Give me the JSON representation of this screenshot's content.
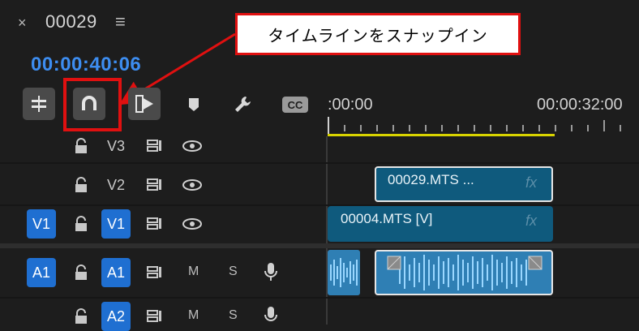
{
  "sequence": {
    "close_glyph": "×",
    "name": "00029",
    "menu_glyph": "≡",
    "timecode": "00:00:40:06"
  },
  "callout": {
    "text": "タイムラインをスナップイン"
  },
  "toolbar": {
    "cc_label": "CC"
  },
  "ruler": {
    "start_label": ":00:00",
    "mark_label": "00:00:32:00"
  },
  "tracks": {
    "v3": {
      "name": "V3"
    },
    "v2": {
      "name": "V2"
    },
    "v1": {
      "source": "V1",
      "name": "V1"
    },
    "a1": {
      "source": "A1",
      "name": "A1",
      "mute": "M",
      "solo": "S"
    },
    "a2": {
      "name": "A2",
      "mute": "M",
      "solo": "S"
    }
  },
  "clips": {
    "v2_clip": {
      "name": "00029.MTS ...",
      "fx": "fx"
    },
    "v1_clip": {
      "name": "00004.MTS [V]",
      "fx": "fx"
    }
  },
  "colors": {
    "accent_blue": "#1f6fd1",
    "timecode_blue": "#3d8df0",
    "clip_video": "#0f5a7d",
    "clip_audio": "#2f7fb4",
    "callout_red": "#e01010",
    "work_area_yellow": "#d9d400"
  }
}
